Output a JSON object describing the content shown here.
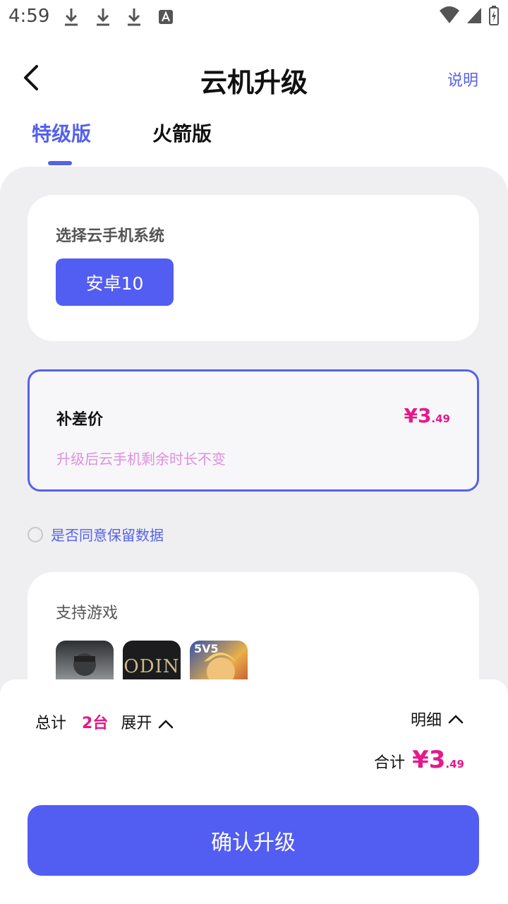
{
  "status_bar": {
    "time": "4:59"
  },
  "header": {
    "title": "云机升级",
    "help_label": "说明"
  },
  "tabs": [
    {
      "label": "特级版",
      "active": true
    },
    {
      "label": "火箭版",
      "active": false
    }
  ],
  "system_card": {
    "label": "选择云手机系统",
    "selected_option": "安卓10"
  },
  "price_card": {
    "label": "补差价",
    "currency": "¥",
    "amount_int": "3",
    "amount_dec": ".49",
    "note": "升级后云手机剩余时长不变"
  },
  "agree": {
    "label": "是否同意保留数据",
    "checked": false
  },
  "games_card": {
    "label": "支持游戏",
    "games": [
      {
        "icon": "soldier-game-icon"
      },
      {
        "icon": "odin-game-icon",
        "text": "ODIN"
      },
      {
        "icon": "5v5-game-icon",
        "text": "5V5"
      }
    ]
  },
  "summary": {
    "total_label": "总计",
    "count": "2台",
    "expand_label": "展开",
    "detail_label": "明细",
    "sum_label": "合计",
    "currency": "¥",
    "amount_int": "3",
    "amount_dec": ".49"
  },
  "confirm_button": "确认升级",
  "colors": {
    "accent": "#525df2",
    "price": "#e5198a"
  }
}
